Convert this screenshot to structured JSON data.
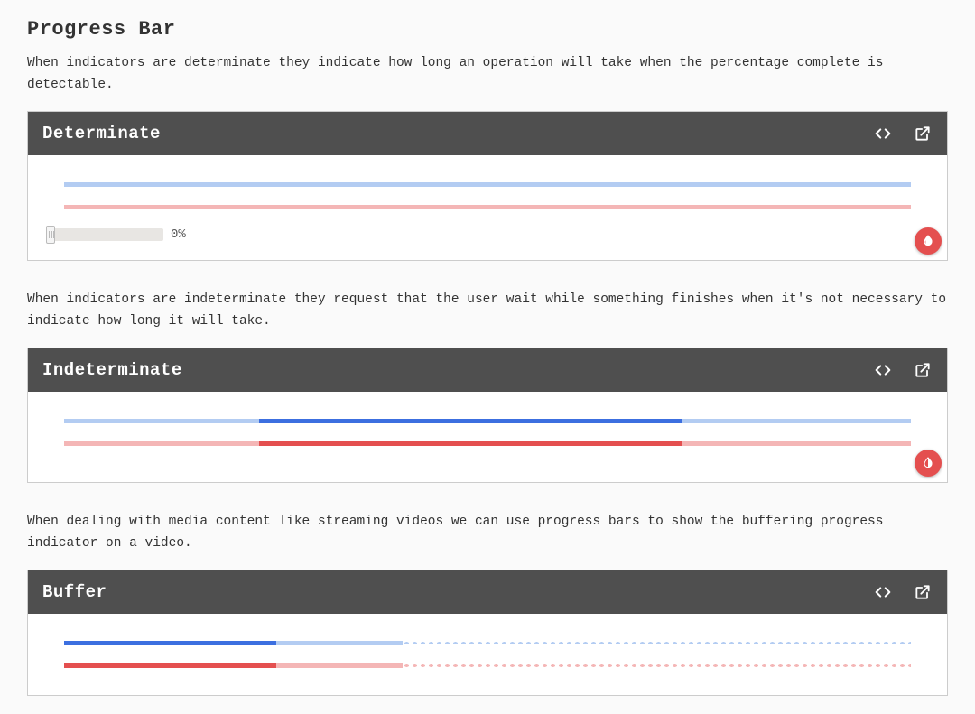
{
  "page": {
    "title": "Progress Bar"
  },
  "sections": {
    "determinate": {
      "description": "When indicators are determinate they indicate how long an operation will take when the percentage complete is detectable.",
      "cardTitle": "Determinate",
      "sliderLabel": "0%",
      "value": 0
    },
    "indeterminate": {
      "description": "When indicators are indeterminate they request that the user wait while something finishes when it's not necessary to indicate how long it will take.",
      "cardTitle": "Indeterminate",
      "segmentStartPct": 23,
      "segmentEndPct": 73
    },
    "buffer": {
      "description": "When dealing with media content like streaming videos we can use progress bars to show the buffering progress indicator on a video.",
      "cardTitle": "Buffer",
      "valuePct": 25,
      "bufferedPct": 40
    }
  },
  "colors": {
    "primary": "#3c6fe0",
    "primaryLight": "#b3ccf2",
    "accent": "#e44f4f",
    "accentLight": "#f4b6b6",
    "headerBg": "#4f4f4f"
  },
  "icons": {
    "code": "code-icon",
    "openNew": "open-in-new-icon",
    "invert": "invert-colors-icon"
  }
}
